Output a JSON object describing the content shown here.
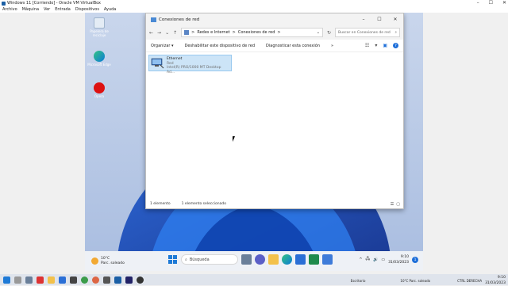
{
  "vbox": {
    "title": "Windows 11 [Corriendo] - Oracle VM VirtualBox",
    "menu": [
      "Archivo",
      "Máquina",
      "Ver",
      "Entrada",
      "Dispositivos",
      "Ayuda"
    ],
    "controls": {
      "min": "–",
      "max": "☐",
      "close": "✕"
    }
  },
  "desktop": {
    "icons": [
      {
        "label": "Papelera de reciclaje",
        "icon": "recycle-bin-icon"
      },
      {
        "label": "Microsoft Edge",
        "icon": "edge-icon"
      },
      {
        "label": "Opera",
        "icon": "opera-icon"
      }
    ]
  },
  "window": {
    "title": "Conexiones de red",
    "controls": {
      "min": "–",
      "max": "☐",
      "close": "✕"
    },
    "breadcrumb": [
      "Redes e Internet",
      "Conexiones de red"
    ],
    "breadcrumb_sep": ">",
    "search_placeholder": "Buscar en Conexiones de red",
    "commands": {
      "organize": "Organizar",
      "organize_caret": "▾",
      "disable": "Deshabilitar este dispositivo de red",
      "diagnose": "Diagnosticar esta conexión",
      "more": "»"
    },
    "item": {
      "name": "Ethernet",
      "network": "Red",
      "adapter": "Intel(R) PRO/1000 MT Desktop Ad..."
    },
    "status": {
      "count": "1 elemento",
      "selected": "1 elemento seleccionado"
    }
  },
  "taskbar": {
    "weather_temp": "10°C",
    "weather_desc": "Parc. soleado",
    "search_label": "Búsqueda",
    "time": "9:10",
    "date": "31/03/2023",
    "notification_count": "1"
  },
  "host_taskbar": {
    "escritorio": "Escritorio",
    "weather": "10°C  Parc. soleado",
    "ctrl_label": "CTRL DERECHA",
    "time": "9:10",
    "date": "31/03/2023"
  },
  "colors": {
    "accent": "#0067c0",
    "selection": "#cce4f7"
  }
}
